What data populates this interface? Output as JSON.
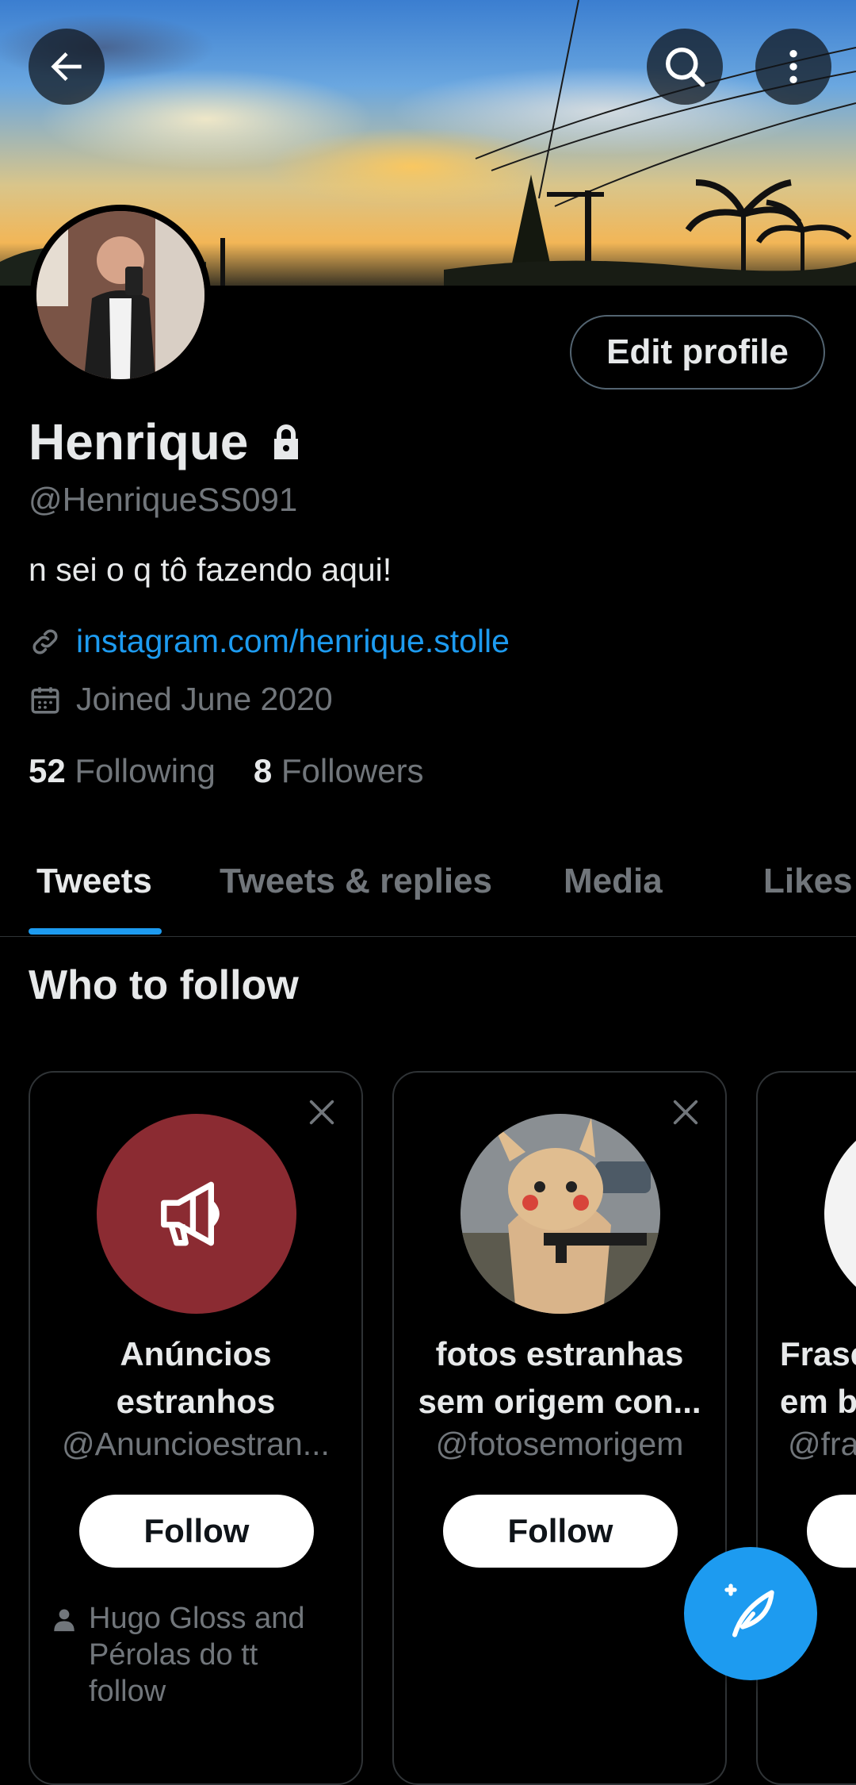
{
  "header": {
    "back_icon": "arrow-left-icon",
    "search_icon": "search-icon",
    "more_icon": "more-vertical-icon"
  },
  "profile": {
    "name": "Henrique",
    "protected_icon": "lock-icon",
    "handle": "@HenriqueSS091",
    "bio": "n sei o q tô fazendo aqui!",
    "link": "instagram.com/henrique.stolle",
    "joined": "Joined June 2020",
    "following_count": "52",
    "following_label": "Following",
    "followers_count": "8",
    "followers_label": "Followers",
    "edit_button": "Edit profile"
  },
  "tabs": [
    {
      "label": "Tweets",
      "active": true
    },
    {
      "label": "Tweets & replies",
      "active": false
    },
    {
      "label": "Media",
      "active": false
    },
    {
      "label": "Likes",
      "active": false
    }
  ],
  "who_to_follow": {
    "title": "Who to follow",
    "follow_label": "Follow",
    "cards": [
      {
        "name_line1": "Anúncios",
        "name_line2": "estranhos",
        "handle": "@Anuncioestran...",
        "social_line1": "Hugo Gloss and",
        "social_line2": "Pérolas do tt",
        "social_line3": "follow",
        "avatar_icon": "megaphone-icon",
        "avatar_color": "#8b2b32"
      },
      {
        "name_line1": "fotos estranhas",
        "name_line2": "sem origem con...",
        "handle": "@fotosemorigem"
      },
      {
        "name_line1": "Frase",
        "name_line2": "em b",
        "handle": "@fra"
      }
    ]
  },
  "fab": {
    "icon": "compose-tweet-icon"
  },
  "colors": {
    "accent": "#1d9bf0",
    "background": "#000000",
    "muted": "#71767b"
  }
}
